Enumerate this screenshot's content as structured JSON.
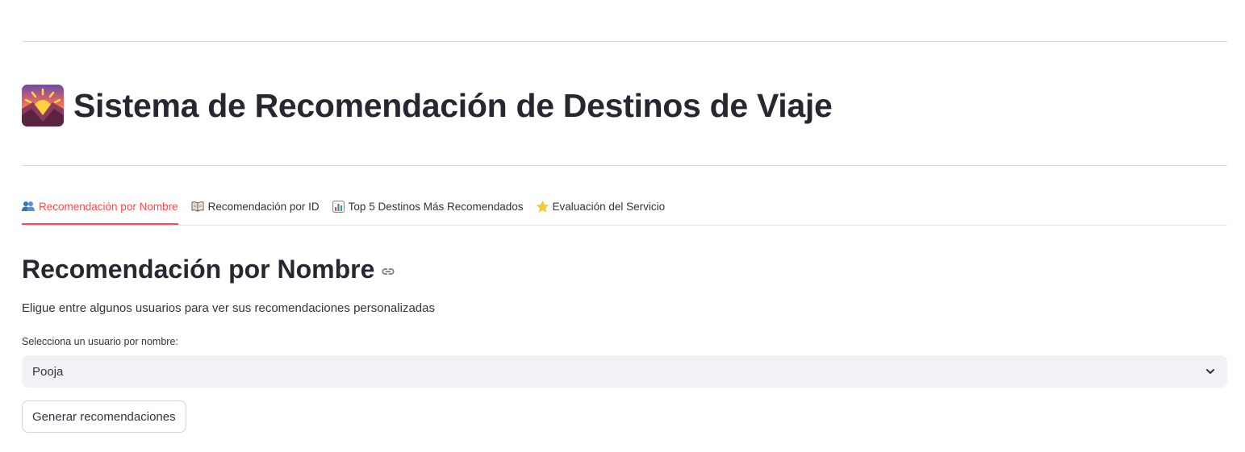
{
  "header": {
    "title": "Sistema de Recomendación de Destinos de Viaje",
    "title_icon": "sunrise-over-mountains-icon"
  },
  "tabs": [
    {
      "label": "Recomendación por Nombre",
      "icon": "people-icon",
      "active": true
    },
    {
      "label": "Recomendación por ID",
      "icon": "open-book-icon",
      "active": false
    },
    {
      "label": "Top 5 Destinos Más Recomendados",
      "icon": "bar-chart-icon",
      "active": false
    },
    {
      "label": "Evaluación del Servicio",
      "icon": "star-icon",
      "active": false
    }
  ],
  "main": {
    "heading": "Recomendación por Nombre",
    "heading_icon": "link-icon",
    "description": "Eligue entre algunos usuarios para ver sus recomendaciones personalizadas",
    "select": {
      "label": "Selecciona un usuario por nombre:",
      "value": "Pooja",
      "icon": "chevron-down-icon"
    },
    "button_label": "Generar recomendaciones"
  },
  "colors": {
    "accent": "#ff4b4b",
    "text": "#31333f",
    "select_bg": "#f0f2f6"
  }
}
